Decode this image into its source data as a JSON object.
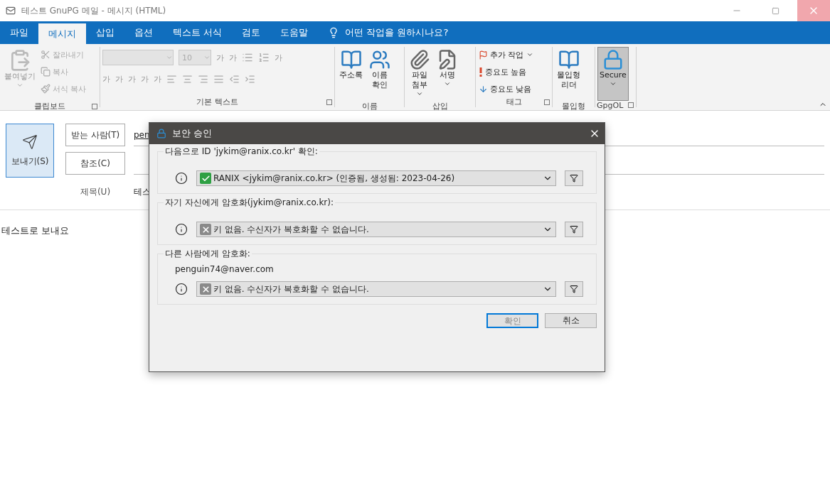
{
  "window": {
    "title": "테스트 GnuPG 메일 - 메시지 (HTML)"
  },
  "tabs": [
    {
      "label": "파일",
      "selected": false
    },
    {
      "label": "메시지",
      "selected": true
    },
    {
      "label": "삽입",
      "selected": false
    },
    {
      "label": "옵션",
      "selected": false
    },
    {
      "label": "텍스트 서식",
      "selected": false
    },
    {
      "label": "검토",
      "selected": false
    },
    {
      "label": "도움말",
      "selected": false
    }
  ],
  "tell_me": {
    "placeholder": "어떤 작업을 원하시나요?"
  },
  "ribbon": {
    "clipboard": {
      "label": "클립보드",
      "disabled": true,
      "paste": "붙여넣기",
      "items": [
        "잘라내기",
        "복사",
        "서식 복사"
      ]
    },
    "basic_text": {
      "label": "기본 텍스트",
      "disabled": true,
      "font_size": "10",
      "glyphs_top": [
        "가",
        "가",
        "가"
      ],
      "glyphs_bottom": [
        "가",
        "가",
        "가",
        "가",
        "가"
      ]
    },
    "names": {
      "label": "이름",
      "items": [
        "주소록",
        "이름\n확인"
      ]
    },
    "insert": {
      "label": "삽입",
      "items": [
        "파일\n첨부",
        "서명"
      ]
    },
    "tags": {
      "label": "태그",
      "items": [
        "추가 작업",
        "중요도 높음",
        "중요도 낮음"
      ]
    },
    "immersive": {
      "label": "몰입형",
      "items": [
        "몰입형\n리더"
      ]
    },
    "gpgol": {
      "label": "GpgOL",
      "secure": "Secure",
      "pressed": true
    }
  },
  "compose": {
    "send": "보내기(S)",
    "to_button": "받는 사람(T)",
    "to_value": "pen",
    "cc_button": "참조(C)",
    "subject_label": "제목(U)",
    "subject_value": "테스",
    "body": "테스트로 보내요"
  },
  "dialog": {
    "title": "보안 승인",
    "sections": [
      {
        "heading": "다음으로 ID 'jykim@ranix.co.kr' 확인:",
        "key": {
          "ok": true,
          "text": "RANIX <jykim@ranix.co.kr> (인증됨, 생성됨: 2023-04-26)"
        }
      },
      {
        "heading": "자기 자신에게 암호화(jykim@ranix.co.kr):",
        "key": {
          "ok": false,
          "text": "키 없음. 수신자가 복호화할 수 없습니다."
        }
      },
      {
        "heading": "다른 사람에게 암호화:",
        "recipient": "penguin74@naver.com",
        "key": {
          "ok": false,
          "text": "키 없음. 수신자가 복호화할 수 없습니다."
        }
      }
    ],
    "buttons": [
      {
        "label": "확인",
        "default": true
      },
      {
        "label": "취소",
        "default": false
      }
    ]
  }
}
